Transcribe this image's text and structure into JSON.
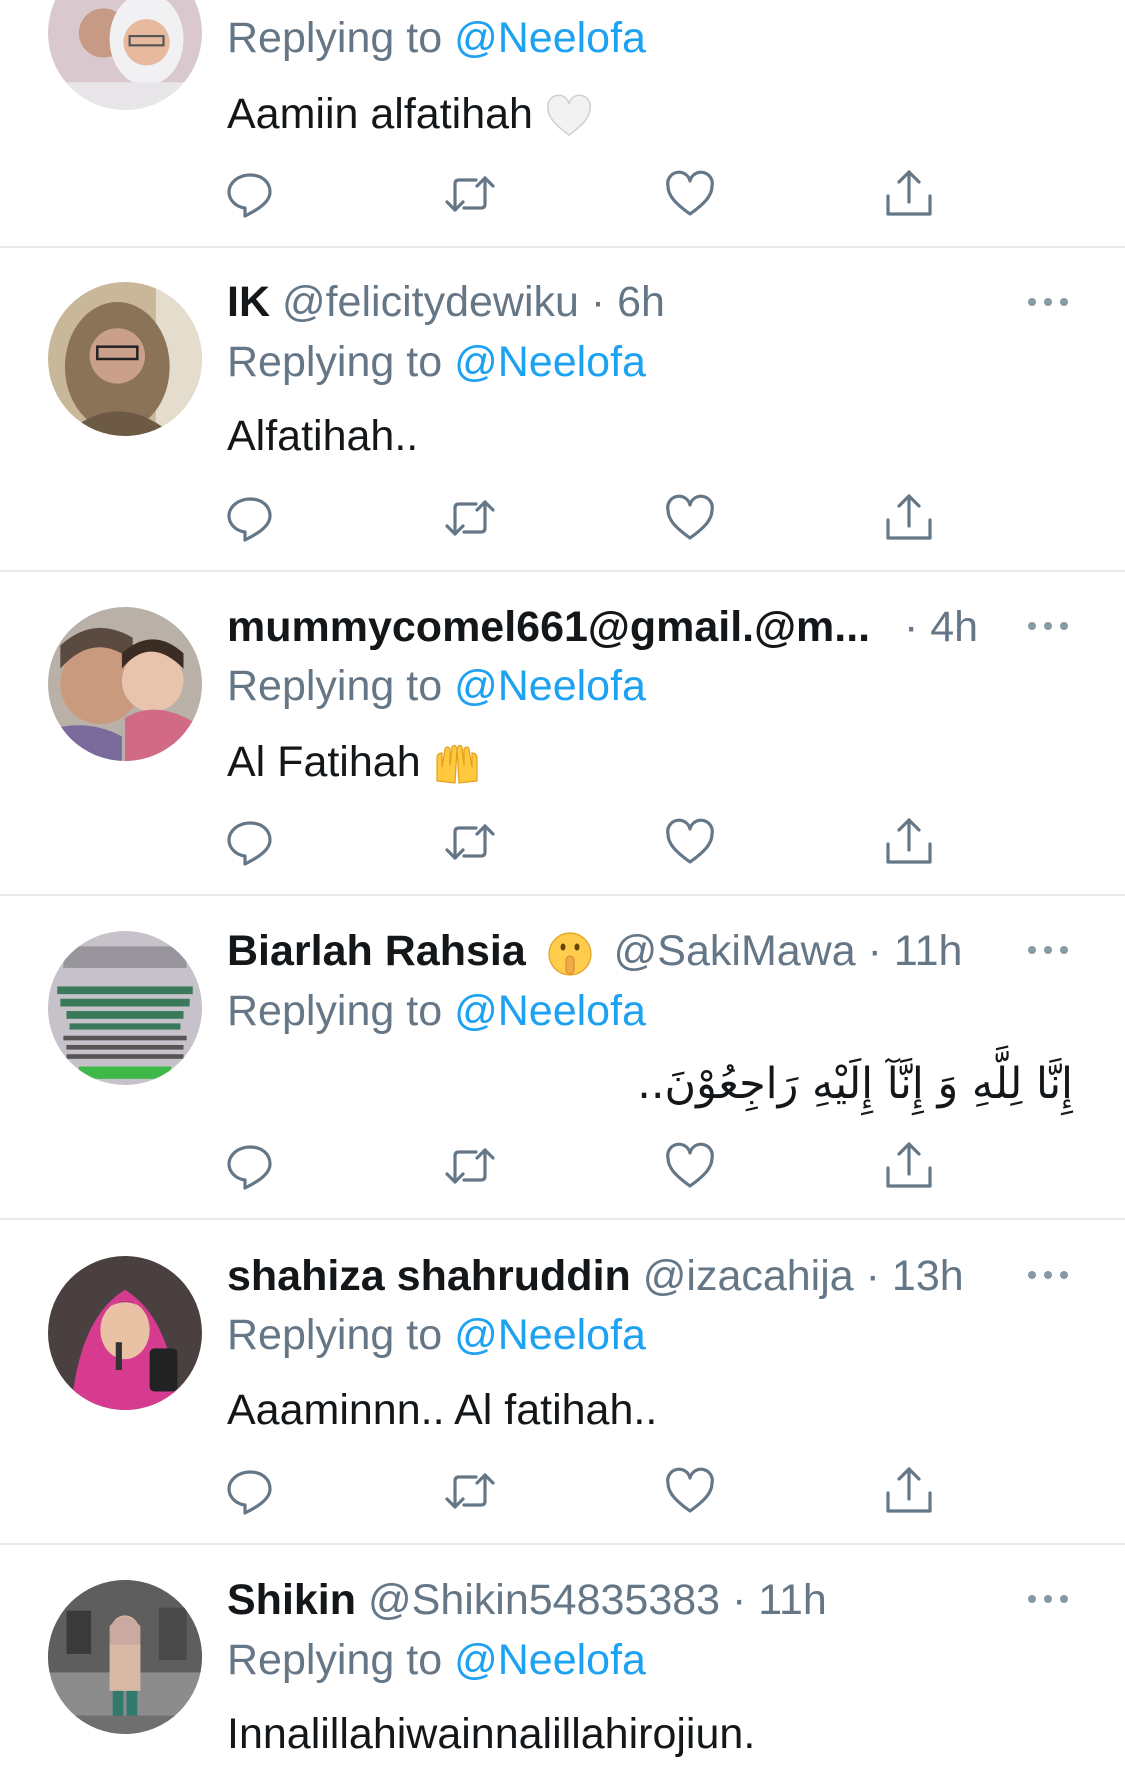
{
  "tweets": [
    {
      "name": "",
      "handle": "",
      "sep": "",
      "time": "",
      "replying_prefix": "Replying to ",
      "replying_handle": "@Neelofa",
      "text": "Aamiin alfatihah",
      "emoji": "white-heart",
      "avatar": "two-people-selfie"
    },
    {
      "name": "IK",
      "handle": "@felicitydewiku",
      "sep": "·",
      "time": "6h",
      "replying_prefix": "Replying to ",
      "replying_handle": "@Neelofa",
      "text": "Alfatihah..",
      "emoji": "",
      "avatar": "woman-glasses-scarf"
    },
    {
      "name": "mummycomel661@gmail.@m...",
      "handle": "",
      "sep": "·",
      "time": "4h",
      "replying_prefix": "Replying to ",
      "replying_handle": "@Neelofa",
      "text": "Al Fatihah",
      "emoji": "raising-hands",
      "avatar": "mother-and-child"
    },
    {
      "name": "Biarlah Rahsia",
      "handle": "@SakiMawa",
      "sep": "·",
      "time": "11h",
      "replying_prefix": "Replying to ",
      "replying_handle": "@Neelofa",
      "text": "إِنَّا لِلَّهِ وَ إِنَّآ إِلَيْهِ رَاجِعُوْنَ..",
      "emoji": "shushing-face",
      "avatar": "text-poster"
    },
    {
      "name": "shahiza shahruddin",
      "handle": "@izacahija",
      "sep": "·",
      "time": "13h",
      "replying_prefix": "Replying to ",
      "replying_handle": "@Neelofa",
      "text": "Aaaminnn.. Al fatihah..",
      "emoji": "",
      "avatar": "woman-pink-hijab"
    },
    {
      "name": "Shikin",
      "handle": "@Shikin54835383",
      "sep": "·",
      "time": "11h",
      "replying_prefix": "Replying to ",
      "replying_handle": "@Neelofa",
      "text": "Innalillahiwainnalillahirojiun.",
      "emoji": "",
      "avatar": "woman-standing-outdoors"
    }
  ],
  "actions": [
    "reply-icon",
    "retweet-icon",
    "like-icon",
    "share-icon"
  ],
  "colors": {
    "link": "#1da1f2",
    "secondary_text": "#657786",
    "primary_text": "#14171a",
    "divider": "#e6e8ea"
  }
}
